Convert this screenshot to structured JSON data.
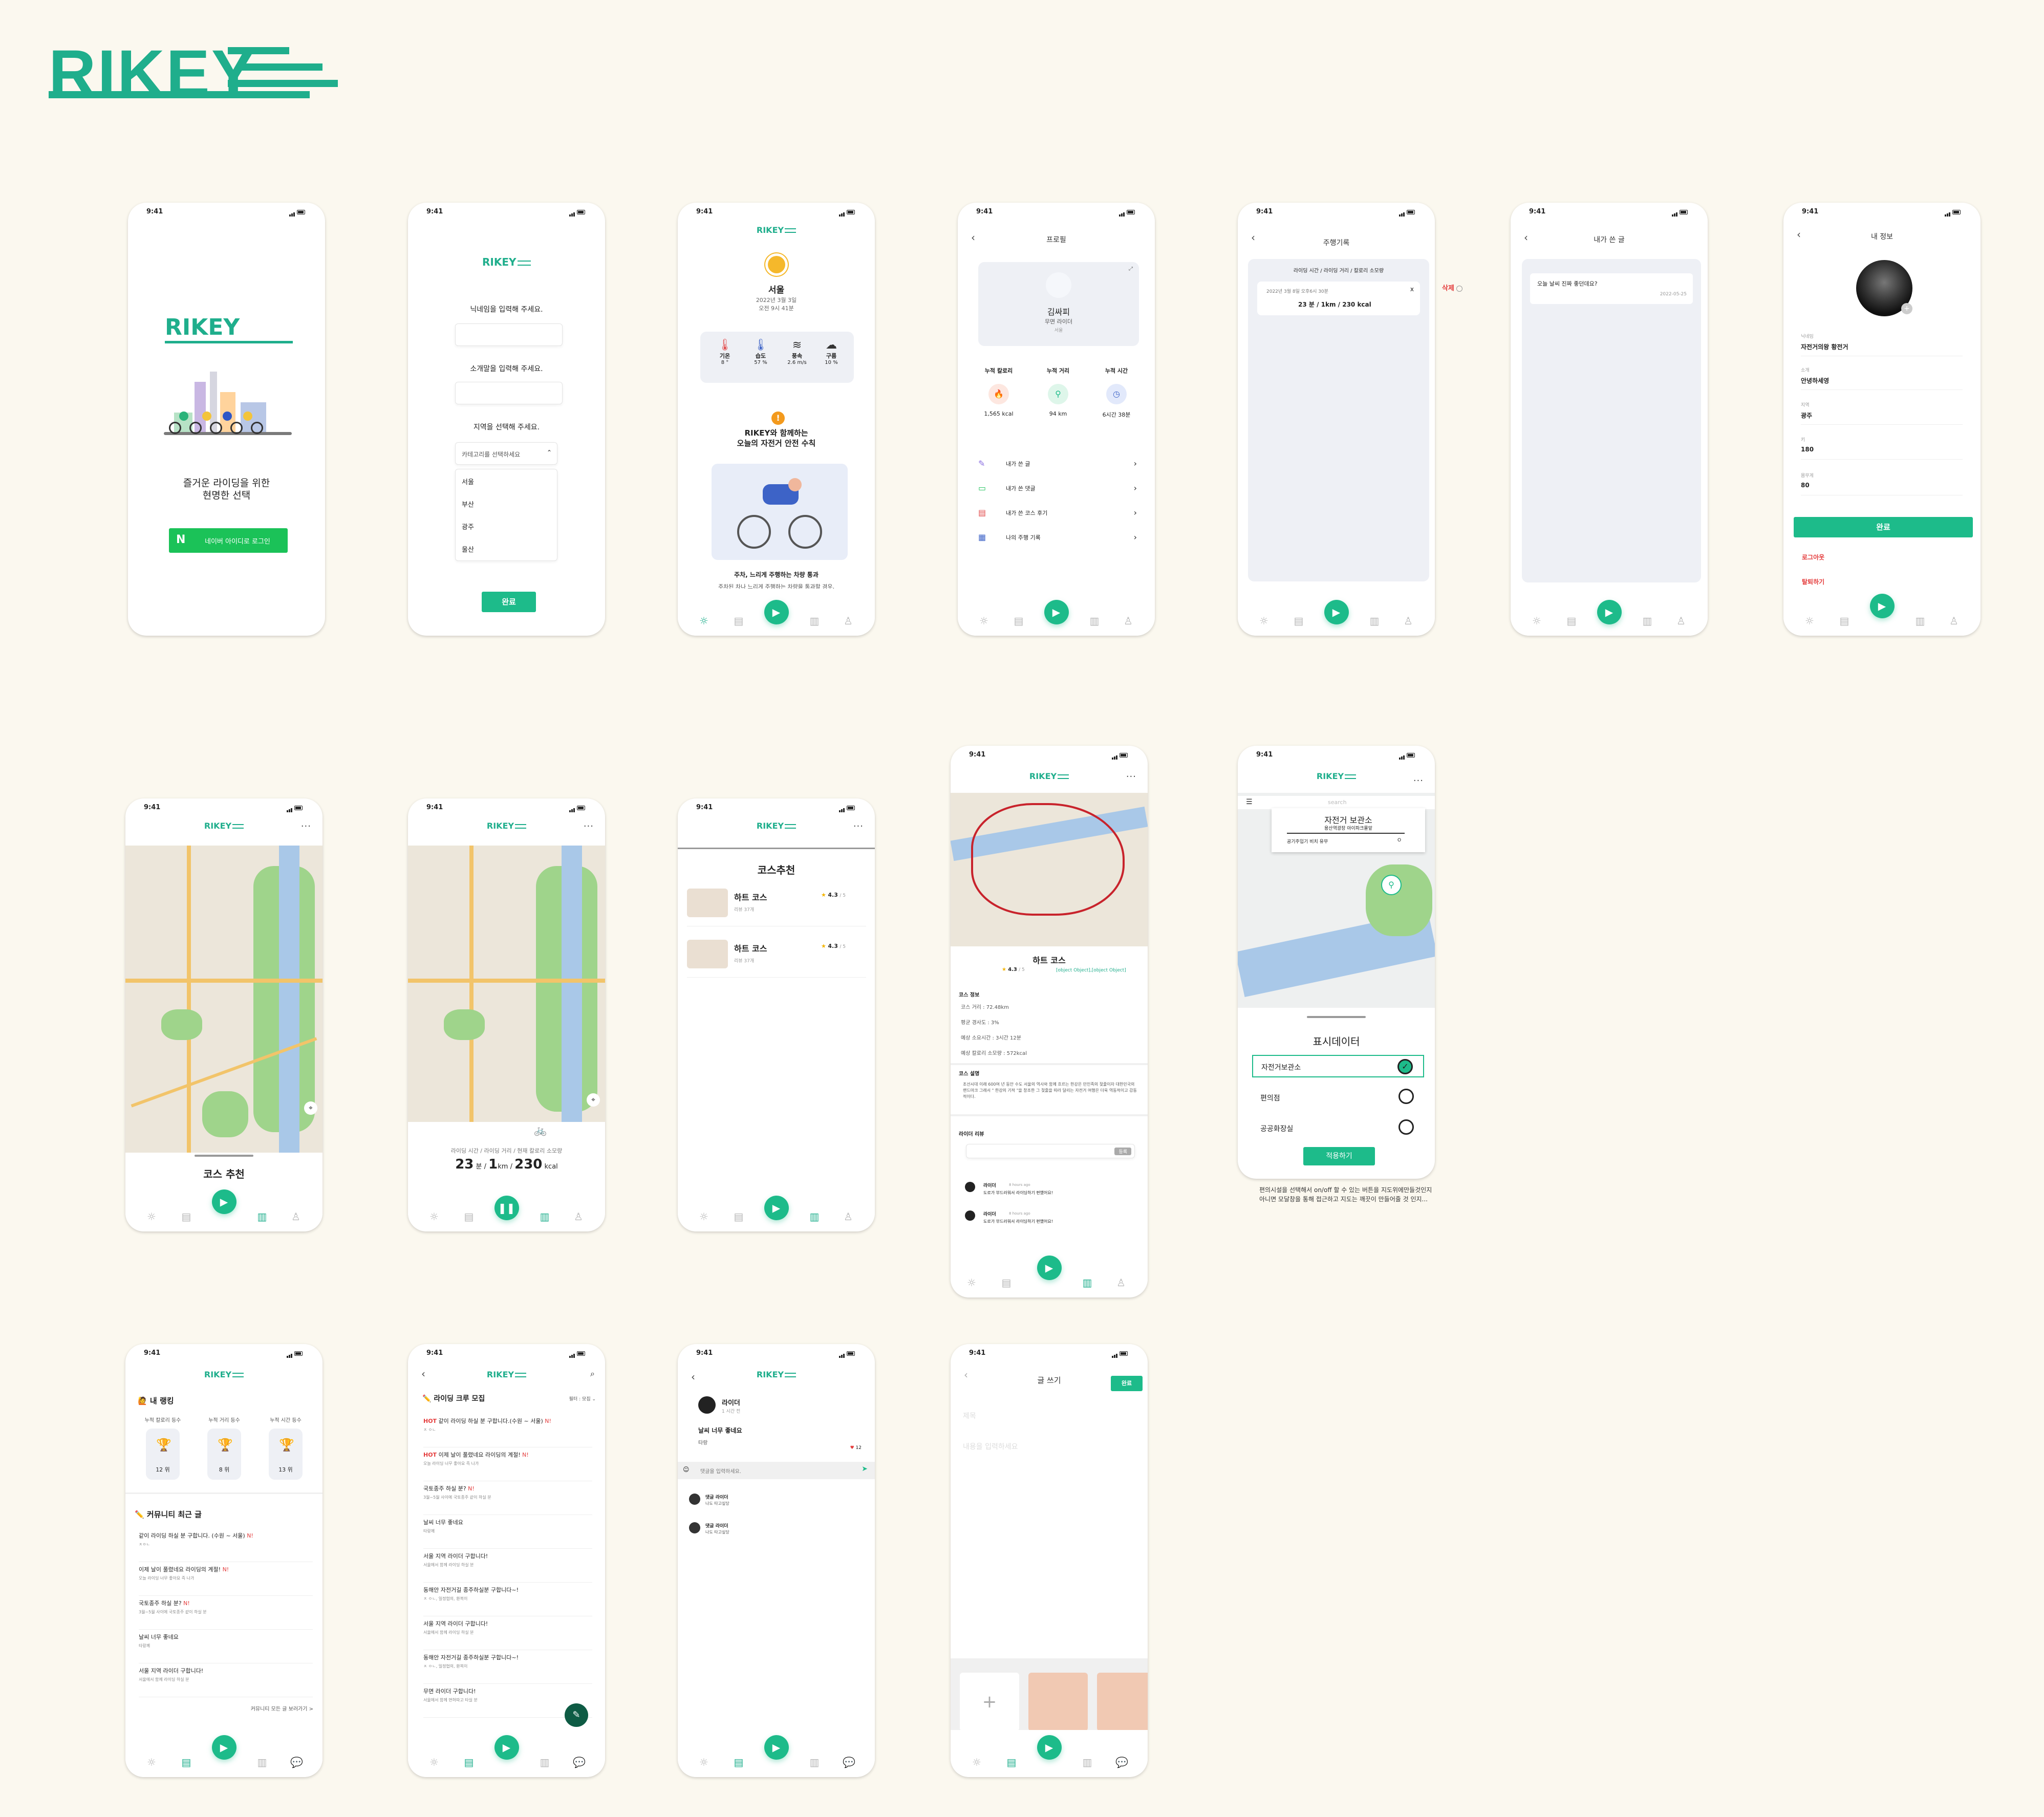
{
  "brand": "RIKEY",
  "status_time": "9:41",
  "s1": {
    "logo": "RIKEY",
    "slogan1": "즐거운 라이딩을 위한",
    "slogan2": "현명한 선택",
    "login": "네이버 아이디로 로그인",
    "naver_mark": "N"
  },
  "s2": {
    "logo": "RIKEY",
    "nick": "닉네임을 입력해 주세요.",
    "intro": "소개말을 입력해 주세요.",
    "region": "지역을 선택해 주세요.",
    "select": "카테고리를 선택하세요",
    "options": [
      "서울",
      "부산",
      "광주",
      "울산"
    ],
    "done": "완료"
  },
  "s3": {
    "logo": "RIKEY",
    "city": "서울",
    "date": "2022년 3월 3일",
    "time": "오전 9시 41분",
    "weather": [
      {
        "label": "기온",
        "value": "8 °"
      },
      {
        "label": "습도",
        "value": "57 %"
      },
      {
        "label": "풍속",
        "value": "2.6 m/s"
      },
      {
        "label": "구름",
        "value": "10 %"
      }
    ],
    "safety1": "RIKEY와 함께하는",
    "safety2": "오늘의 자전거 안전 수칙",
    "tip_title": "주차, 느리게 주행하는 차량 통과",
    "tip_text": "주차된 차나 느리게 주행하는 차량을 통과할 경우,"
  },
  "s4": {
    "title": "프로필",
    "name": "김싸피",
    "role": "무면 라이더",
    "region": "서울",
    "stats": [
      {
        "label": "누적 칼로리",
        "value": "1,565 kcal"
      },
      {
        "label": "누적 거리",
        "value": "94 km"
      },
      {
        "label": "누적 시간",
        "value": "6시간 38분"
      }
    ],
    "menu": [
      "내가 쓴 글",
      "내가 쓴 댓글",
      "내가 쓴 코스 후기",
      "나의 주행 기록"
    ]
  },
  "s5": {
    "title": "주행기록",
    "header": "라이딩 시간 / 라이딩 거리 / 칼로리 소모량",
    "date": "2022년 3월 8일 오후6시 30분",
    "value": "23 분 / 1km / 230 kcal",
    "delete": "삭제"
  },
  "s6": {
    "title": "내가 쓴 글",
    "post": "오늘 날씨 진짜 좋던데요?",
    "date": "2022-05-25"
  },
  "s7": {
    "title": "내 정보",
    "fields": [
      {
        "label": "닉네임",
        "value": "자전거의왕 황전거"
      },
      {
        "label": "소개",
        "value": "안녕하세영"
      },
      {
        "label": "지역",
        "value": "광주"
      },
      {
        "label": "키",
        "value": "180"
      },
      {
        "label": "몸무게",
        "value": "80"
      }
    ],
    "done": "완료",
    "logout": "로그아웃",
    "withdraw": "탈퇴하기"
  },
  "s8": {
    "logo": "RIKEY",
    "course": "코스 추천"
  },
  "s9": {
    "logo": "RIKEY",
    "header": "라이딩 시간 / 라이딩 거리 / 현재 칼로리 소모량",
    "v1": "23",
    "u1": "분",
    "v2": "1",
    "u2": "km",
    "v3": "230",
    "u3": "kcal"
  },
  "s10": {
    "logo": "RIKEY",
    "title": "코스추천",
    "items": [
      {
        "name": "하트 코스",
        "rating": "4.3",
        "of": "/ 5",
        "reviews": "리뷰 37개"
      },
      {
        "name": "하트 코스",
        "rating": "4.3",
        "of": "/ 5",
        "reviews": "리뷰 37개"
      }
    ]
  },
  "s11": {
    "logo": "RIKEY",
    "name": "하트 코스",
    "rating": "4.3",
    "of": "/ 5",
    "reviews": [
      {
        "user": "라이더",
        "time": "8 hours ago",
        "text": "도로가 부드러워서 라이딩하기 편했어요!"
      },
      {
        "user": "라이더",
        "time": "8 hours ago",
        "text": "도로가 부드러워서 라이딩하기 편했어요!"
      }
    ],
    "info_title": "코스 정보",
    "info": [
      "코스 거리 : 72.48km",
      "평균 경사도 : 3%",
      "예상 소요시간 : 3시간 12분",
      "예상 칼로리 소모량 : 572kcal"
    ],
    "desc_title": "코스 설명",
    "desc": "조선시대 이래 600여 년 동안 수도 서울의 역사와 함께 흐르는 한강은 민인족의 젖줄이자 대한민국의 랜드마크 그래서 \" 한강의 기적 \"을 창조한 그 젖줄을 따라 달리는 자전거 여행은 더욱 역동적이고 감동적이다.",
    "review_title": "라이더 리뷰",
    "review_btn": "등록"
  },
  "s12": {
    "logo": "RIKEY",
    "search": "search",
    "popup_title": "자전거 보관소",
    "popup_sub": "용산역광장 아이파크몰앞",
    "popup_row": "공기주입기 비치 유무",
    "popup_val": "O",
    "panel_title": "표시데이터",
    "options": [
      "자전거보관소",
      "편의점",
      "공공화장실"
    ],
    "apply": "적용하기",
    "note1": "편의시설을 선택해서 on/off 할 수 있는 버튼을 지도위에만들것인지",
    "note2": "아니면 모달창을 통해 접근하고 지도는 깨끗이 만들어줄 것 인지..."
  },
  "s13": {
    "logo": "RIKEY",
    "rank_title": "내 랭킹",
    "ranks": [
      {
        "label": "누적 칼로리 등수",
        "value": "12 위",
        "color": "#f0753e"
      },
      {
        "label": "누적 거리 등수",
        "value": "8 위",
        "color": "#52b95f"
      },
      {
        "label": "누적 시간 등수",
        "value": "13 위",
        "color": "#4e6fd7"
      }
    ],
    "comm_title": "커뮤니티 최근 글",
    "posts": [
      {
        "t": "같이 라이딩 하실 분 구합니다. (수원 ~ 서울)",
        "n": "N!",
        "s": "ㅈㅇㄴ"
      },
      {
        "t": "이제 날이 풀렸네요 라이딩의 계절!",
        "n": "N!",
        "s": "오늘 라이딩 너무 좋아요 즉 나가"
      },
      {
        "t": "국토종주 하실 분?",
        "n": "N!",
        "s": "3월~5월 사이에 국토종주 같이 하실 분"
      },
      {
        "t": "날씨 너무 좋네요",
        "n": "",
        "s": "타랑께"
      },
      {
        "t": "서울 지역 라이더 구합니다!",
        "n": "",
        "s": "서울에서 함께 라이딩 하실 분"
      }
    ],
    "more": "커뮤니티 모든 글 보러가기 >"
  },
  "s14": {
    "logo": "RIKEY",
    "title": "라이딩 크루 모집",
    "filter": "필터 : 모집",
    "hot": "HOT",
    "posts": [
      {
        "t": "같이 라이딩 하실 분 구합니다.(수원 ~ 서울)",
        "n": "N!",
        "s": "ㅈ ㅇㄴ",
        "hot": true
      },
      {
        "t": "이제 날이 풀렸네요 라이딩의 계절!",
        "n": "N!",
        "s": "오늘 라이딩 너무 좋아요 즉 나가",
        "hot": true
      },
      {
        "t": "국토종주 하실 분?",
        "n": "N!",
        "s": "3월~5월 사이에 국토종주 같이 하실 분",
        "hot": false
      },
      {
        "t": "날씨 너무 좋네요",
        "n": "",
        "s": "타랑께",
        "hot": false
      },
      {
        "t": "서울 지역 라이더 구합니다!",
        "n": "",
        "s": "서울에서 함께 라이딩 하실 분",
        "hot": false
      },
      {
        "t": "동해안 자전거길 종주하실분 구합니다~!",
        "n": "",
        "s": "ㅈ ㅇㄴ, 일정협의, 환복이",
        "hot": false
      },
      {
        "t": "서울 지역 라이더 구합니다!",
        "n": "",
        "s": "서울에서 함께 라이딩 하실 분",
        "hot": false
      },
      {
        "t": "동해안 자전거길 종주하실분 구합니다~!",
        "n": "",
        "s": "ㅈ ㅇㄴ, 일정협의, 환복이",
        "hot": false
      },
      {
        "t": "무면 라이더 구합니다!",
        "n": "",
        "s": "서울에서 함께 면허따고 타실 분",
        "hot": false
      }
    ]
  },
  "s15": {
    "logo": "RIKEY",
    "user": "라이더",
    "time": "1 시간 전",
    "post": "날씨 너무 좋네요",
    "body": "타랑",
    "likes": "12",
    "comment_ph": "댓글을 입력하세요.",
    "comments": [
      {
        "u": "댓글 라이더",
        "t": "나도 타고싶당"
      },
      {
        "u": "댓글 라이더",
        "t": "나도 타고싶당"
      }
    ]
  },
  "s16": {
    "title": "글 쓰기",
    "done": "완료",
    "title_ph": "제목",
    "body_ph": "내용을 입력하세요"
  }
}
